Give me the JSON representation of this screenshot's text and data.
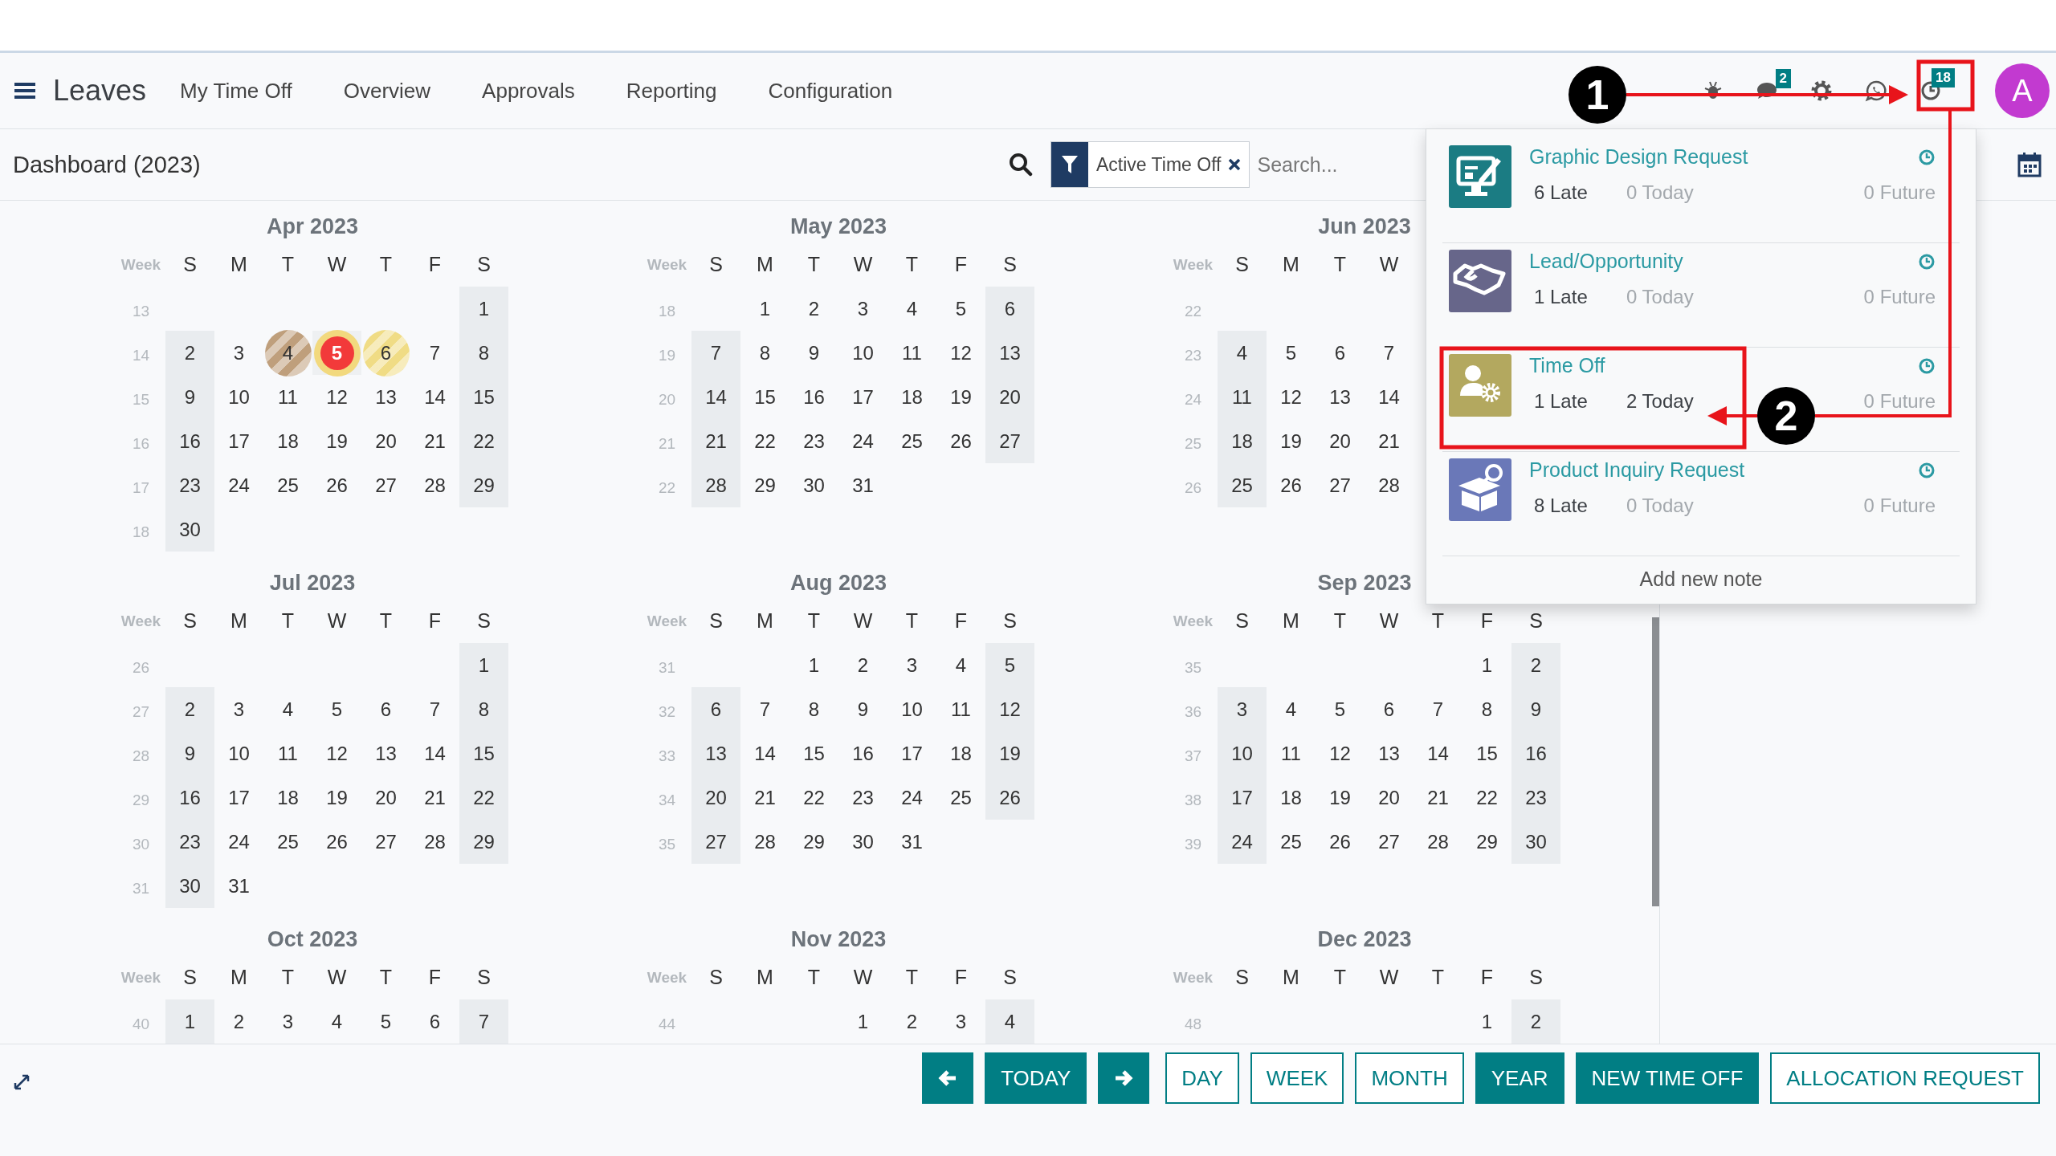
{
  "navbar": {
    "app_title": "Leaves",
    "menu": [
      "My Time Off",
      "Overview",
      "Approvals",
      "Reporting",
      "Configuration"
    ],
    "systray": [
      {
        "kind": "bug"
      },
      {
        "kind": "chat",
        "badge": "2"
      },
      {
        "kind": "gear"
      },
      {
        "kind": "whatsapp"
      },
      {
        "kind": "activity",
        "badge": "18"
      }
    ],
    "avatar": "A"
  },
  "control_panel": {
    "title": "Dashboard (2023)",
    "facets": [
      {
        "label": "Active Time Off"
      }
    ],
    "search": {
      "placeholder": "Search..."
    }
  },
  "calendar": {
    "months": [
      {
        "title": "Apr 2023",
        "week_label": "Week",
        "weekdays": [
          "S",
          "M",
          "T",
          "W",
          "T",
          "F",
          "S"
        ],
        "weeks": [
          {
            "number": "13",
            "days": [
              "1"
            ]
          },
          {
            "number": "14",
            "days": [
              "2",
              "3",
              {
                "label": "4",
                "kind": "striped",
                "color": "#bf9f7c"
              },
              {
                "label": "5",
                "kind": "today",
                "color": "#f2d97e"
              },
              {
                "label": "6",
                "kind": "striped",
                "color": "#f0dc85"
              },
              "7",
              "8"
            ]
          },
          {
            "number": "15",
            "days": [
              "9",
              "10",
              "11",
              "12",
              "13",
              "14",
              "15"
            ]
          },
          {
            "number": "16",
            "days": [
              "16",
              "17",
              "18",
              "19",
              "20",
              "21",
              "22"
            ]
          },
          {
            "number": "17",
            "days": [
              "23",
              "24",
              "25",
              "26",
              "27",
              "28",
              "29"
            ]
          },
          {
            "number": "18",
            "days": [
              "30"
            ]
          }
        ]
      },
      {
        "title": "May 2023",
        "week_label": "Week",
        "weekdays": [
          "S",
          "M",
          "T",
          "W",
          "T",
          "F",
          "S"
        ],
        "weeks": [
          {
            "number": "18",
            "days": [
              "1",
              "2",
              "3",
              "4",
              "5",
              "6"
            ]
          },
          {
            "number": "19",
            "days": [
              "7",
              "8",
              "9",
              "10",
              "11",
              "12",
              "13"
            ]
          },
          {
            "number": "20",
            "days": [
              "14",
              "15",
              "16",
              "17",
              "18",
              "19",
              "20"
            ]
          },
          {
            "number": "21",
            "days": [
              "21",
              "22",
              "23",
              "24",
              "25",
              "26",
              "27"
            ]
          },
          {
            "number": "22",
            "days": [
              "28",
              "29",
              "30",
              "31"
            ]
          }
        ]
      },
      {
        "title": "Jun 2023",
        "week_label": "Week",
        "weekdays": [
          "S",
          "M",
          "T",
          "W"
        ],
        "weeks": [
          {
            "number": "22"
          },
          {
            "number": "23",
            "days": [
              "4",
              "5",
              "6",
              "7"
            ]
          },
          {
            "number": "24",
            "days": [
              "11",
              "12",
              "13",
              "14"
            ]
          },
          {
            "number": "25",
            "days": [
              "18",
              "19",
              "20",
              "21"
            ]
          },
          {
            "number": "26",
            "days": [
              "25",
              "26",
              "27",
              "28"
            ]
          }
        ]
      },
      {
        "title": "Jul 2023",
        "week_label": "Week",
        "weekdays": [
          "S",
          "M",
          "T",
          "W",
          "T",
          "F",
          "S"
        ],
        "weeks": [
          {
            "number": "26",
            "days": [
              "1"
            ]
          },
          {
            "number": "27",
            "days": [
              "2",
              "3",
              "4",
              "5",
              "6",
              "7",
              "8"
            ]
          },
          {
            "number": "28",
            "days": [
              "9",
              "10",
              "11",
              "12",
              "13",
              "14",
              "15"
            ]
          },
          {
            "number": "29",
            "days": [
              "16",
              "17",
              "18",
              "19",
              "20",
              "21",
              "22"
            ]
          },
          {
            "number": "30",
            "days": [
              "23",
              "24",
              "25",
              "26",
              "27",
              "28",
              "29"
            ]
          },
          {
            "number": "31",
            "days": [
              "30",
              "31"
            ]
          }
        ]
      },
      {
        "title": "Aug 2023",
        "week_label": "Week",
        "weekdays": [
          "S",
          "M",
          "T",
          "W",
          "T",
          "F",
          "S"
        ],
        "weeks": [
          {
            "number": "31",
            "days": [
              "1",
              "2",
              "3",
              "4",
              "5"
            ]
          },
          {
            "number": "32",
            "days": [
              "6",
              "7",
              "8",
              "9",
              "10",
              "11",
              "12"
            ]
          },
          {
            "number": "33",
            "days": [
              "13",
              "14",
              "15",
              "16",
              "17",
              "18",
              "19"
            ]
          },
          {
            "number": "34",
            "days": [
              "20",
              "21",
              "22",
              "23",
              "24",
              "25",
              "26"
            ]
          },
          {
            "number": "35",
            "days": [
              "27",
              "28",
              "29",
              "30",
              "31"
            ]
          }
        ]
      },
      {
        "title": "Sep 2023",
        "week_label": "Week",
        "weekdays": [
          "S",
          "M",
          "T",
          "W",
          "T",
          "F",
          "S"
        ],
        "weeks": [
          {
            "number": "35",
            "days": [
              "1",
              "2"
            ]
          },
          {
            "number": "36",
            "days": [
              "3",
              "4",
              "5",
              "6",
              "7",
              "8",
              "9"
            ]
          },
          {
            "number": "37",
            "days": [
              "10",
              "11",
              "12",
              "13",
              "14",
              "15",
              "16"
            ]
          },
          {
            "number": "38",
            "days": [
              "17",
              "18",
              "19",
              "20",
              "21",
              "22",
              "23"
            ]
          },
          {
            "number": "39",
            "days": [
              "24",
              "25",
              "26",
              "27",
              "28",
              "29",
              "30"
            ]
          }
        ]
      },
      {
        "title": "Oct 2023",
        "week_label": "Week",
        "weekdays": [
          "S",
          "M",
          "T",
          "W",
          "T",
          "F",
          "S"
        ],
        "weeks": [
          {
            "number": "40",
            "days": [
              "1",
              "2",
              "3",
              "4",
              "5",
              "6",
              "7"
            ]
          }
        ]
      },
      {
        "title": "Nov 2023",
        "week_label": "Week",
        "weekdays": [
          "S",
          "M",
          "T",
          "W",
          "T",
          "F",
          "S"
        ],
        "weeks": [
          {
            "number": "44",
            "days": [
              "1",
              "2",
              "3",
              "4"
            ]
          }
        ]
      },
      {
        "title": "Dec 2023",
        "week_label": "Week",
        "weekdays": [
          "S",
          "M",
          "T",
          "W",
          "T",
          "F",
          "S"
        ],
        "weeks": [
          {
            "number": "48",
            "days": [
              "1",
              "2"
            ]
          }
        ]
      }
    ]
  },
  "activity_menu": {
    "items": [
      {
        "name": "Graphic Design Request",
        "kind": "design",
        "color": "#1b7c83",
        "counts": [
          {
            "text": "6 Late",
            "muted": false
          },
          {
            "text": "0 Today",
            "muted": true
          },
          {
            "text": "0 Future",
            "muted": true
          }
        ]
      },
      {
        "name": "Lead/Opportunity",
        "kind": "handshake",
        "color": "#67668a",
        "counts": [
          {
            "text": "1 Late",
            "muted": false
          },
          {
            "text": "0 Today",
            "muted": true
          },
          {
            "text": "0 Future",
            "muted": true
          }
        ]
      },
      {
        "name": "Time Off",
        "kind": "person-gear",
        "color": "#b3a85f",
        "counts": [
          {
            "text": "1 Late",
            "muted": false
          },
          {
            "text": "2 Today",
            "muted": false
          },
          {
            "text": "0 Future",
            "muted": true
          }
        ]
      },
      {
        "name": "Product Inquiry Request",
        "kind": "box",
        "color": "#6a78b8",
        "counts": [
          {
            "text": "8 Late",
            "muted": false
          },
          {
            "text": "0 Today",
            "muted": true
          },
          {
            "text": "0 Future",
            "muted": true
          }
        ]
      }
    ],
    "add_note": "Add new note"
  },
  "toolbar": {
    "nav": [
      {
        "kind": "prev"
      },
      {
        "kind": "text",
        "label": "TODAY"
      },
      {
        "kind": "next"
      }
    ],
    "views": [
      {
        "label": "DAY",
        "selected": false
      },
      {
        "label": "WEEK",
        "selected": false
      },
      {
        "label": "MONTH",
        "selected": false
      },
      {
        "label": "YEAR",
        "selected": true
      }
    ],
    "actions": [
      {
        "label": "NEW TIME OFF",
        "kind": "primary"
      },
      {
        "label": "ALLOCATION REQUEST",
        "kind": "secondary"
      }
    ]
  },
  "annotations": [
    {
      "number": "1"
    },
    {
      "number": "2"
    }
  ]
}
